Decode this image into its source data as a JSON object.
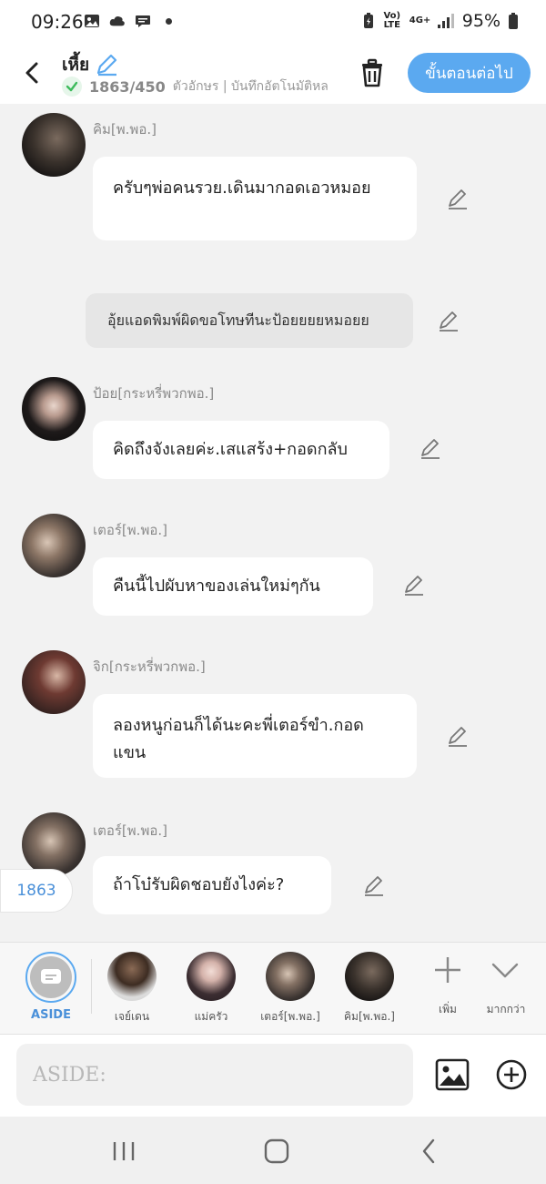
{
  "status_bar": {
    "time": "09:26",
    "icons": [
      "gallery-icon",
      "cloud-icon",
      "chat-icon",
      "dot-icon"
    ],
    "volte": "Vo) LTE",
    "network": "4G+",
    "battery": "95%"
  },
  "header": {
    "title": "เหี้ย",
    "count": "1863/450",
    "subtitle": "ตัวอักษร | บันทึกอัตโนมัติหล",
    "next_label": "ขั้นตอนต่อไป",
    "colors": {
      "accent": "#5ba9f0",
      "check": "#3dbb5c"
    }
  },
  "messages": [
    {
      "name": "คิม[พ.พอ.]",
      "text": "ครับๆพ่อคนรวย.เดินมากอดเอวหมอย",
      "avatar": "avatar-kim"
    },
    {
      "aside": "อุ้ยแอดพิมพ์ผิดขอโทษทีนะป้อยยยยหมอยย"
    },
    {
      "name": "ป้อย[กระหรี่พวกพอ.]",
      "text": "คิดถึงจังเลยค่ะ.เสแสร้ง+กอดกลับ",
      "avatar": "avatar-poy"
    },
    {
      "name": "เตอร์[พ.พอ.]",
      "text": "คืนนี้ไปผับหาของเล่นใหม่ๆกัน",
      "avatar": "avatar-ter"
    },
    {
      "name": "จิก[กระหรี่พวกพอ.]",
      "text": "ลองหนูก่อนก็ได้นะคะพี่เตอร์ขำ.กอดแขน",
      "avatar": "avatar-jik"
    },
    {
      "name": "เตอร์[พ.พอ.]",
      "text": "ถ้าโบ๋รับผิดชอบยังไงค่ะ?",
      "avatar": "avatar-ter"
    }
  ],
  "counter_pill": "1863",
  "character_strip": {
    "aside_label": "ASIDE",
    "characters": [
      {
        "label": "เจย์เดน"
      },
      {
        "label": "แม่ครัว"
      },
      {
        "label": "เตอร์[พ.พอ.]"
      },
      {
        "label": "คิม[พ.พอ.]"
      }
    ],
    "add_label": "เพิ่ม",
    "more_label": "มากกว่า"
  },
  "input": {
    "placeholder": "ASIDE:"
  }
}
